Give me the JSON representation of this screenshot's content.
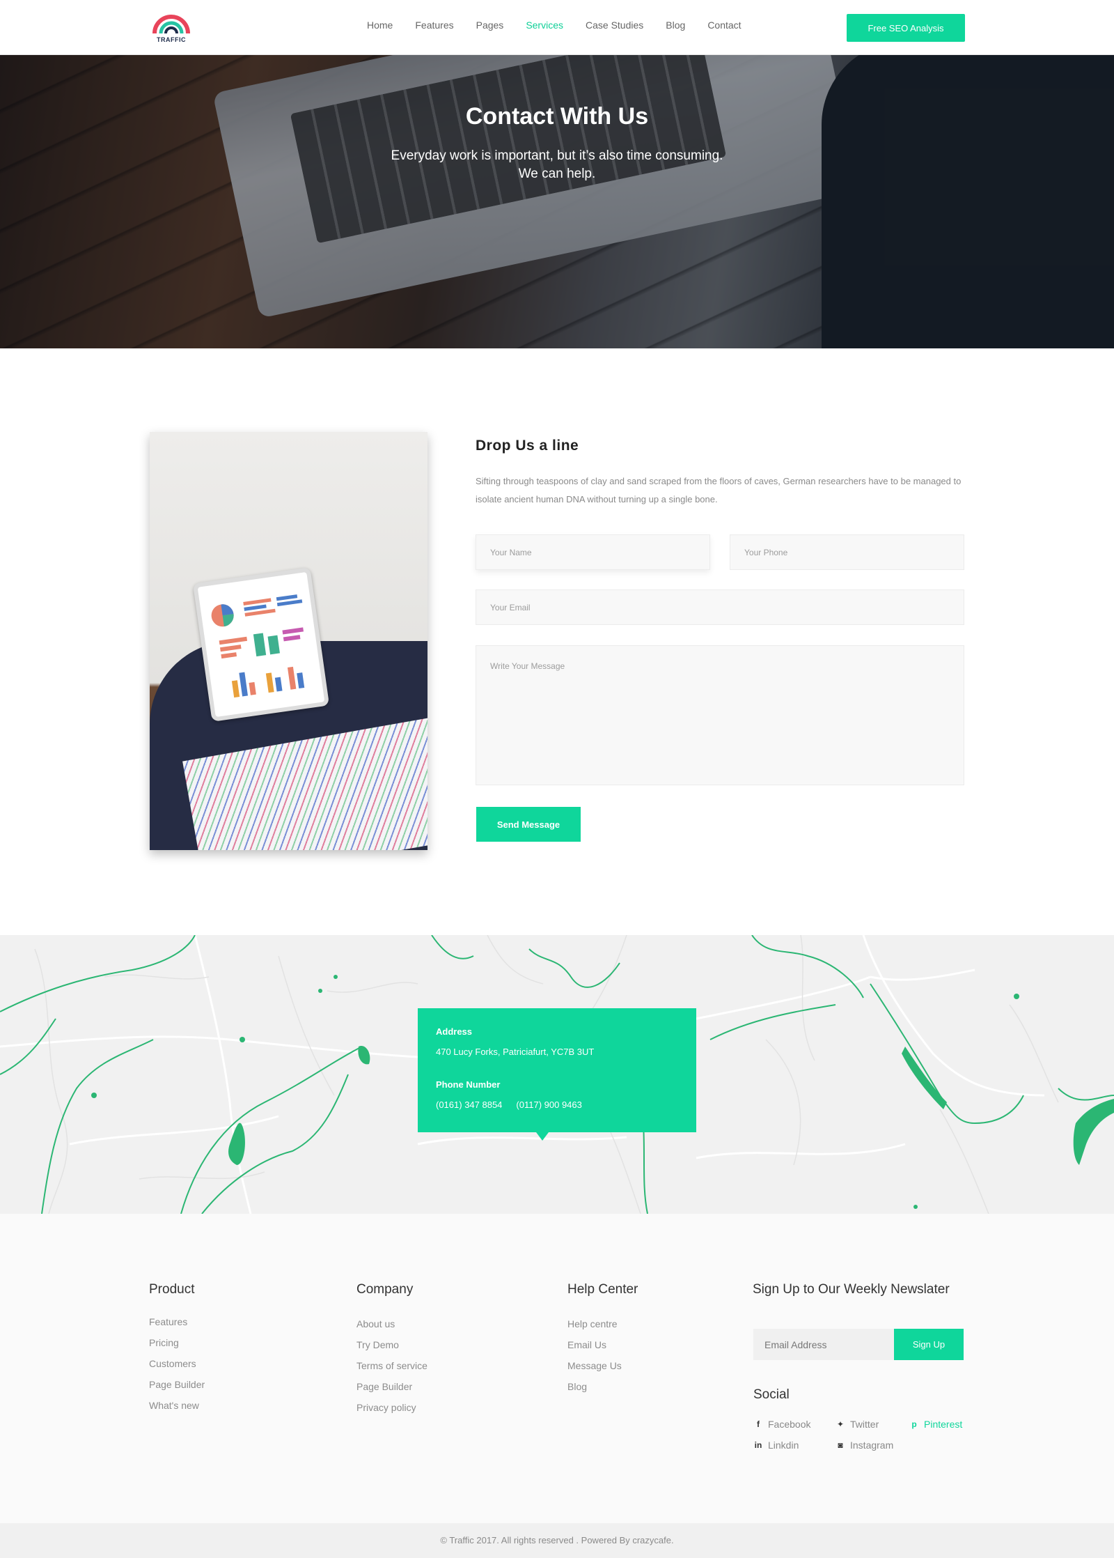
{
  "header": {
    "logo_text": "TRAFFIC",
    "nav": [
      "Home",
      "Features",
      "Pages",
      "Services",
      "Case Studies",
      "Blog",
      "Contact"
    ],
    "active_nav": "Services",
    "cta": "Free SEO Analysis"
  },
  "hero": {
    "title": "Contact With Us",
    "subtitle_line1": "Everyday work is important, but it’s also time consuming.",
    "subtitle_line2": "We can help."
  },
  "contact": {
    "title": "Drop Us a line",
    "description": "Sifting through teaspoons of clay and sand scraped from the floors of caves, German researchers have to be managed to isolate ancient human DNA without turning up a single bone.",
    "name_placeholder": "Your Name",
    "phone_placeholder": "Your Phone",
    "email_placeholder": "Your Email",
    "message_placeholder": "Write Your Message",
    "send_label": "Send Message"
  },
  "map_info": {
    "address_label": "Address",
    "address": "470 Lucy Forks, Patriciafurt, YC7B 3UT",
    "phone_label": "Phone Number",
    "phone1": "(0161) 347 8854",
    "phone2": "(0117) 900 9463"
  },
  "footer": {
    "product": {
      "title": "Product",
      "items": [
        "Features",
        "Pricing",
        "Customers",
        "Page Builder",
        "What's new"
      ]
    },
    "company": {
      "title": "Company",
      "items": [
        "About us",
        "Try Demo",
        "Terms of service",
        "Page Builder",
        "Privacy policy"
      ]
    },
    "help": {
      "title": "Help Center",
      "items": [
        "Help centre",
        "Email Us",
        "Message Us",
        "Blog"
      ]
    },
    "newsletter": {
      "title": "Sign Up to Our Weekly Newslater",
      "placeholder": "Email Address",
      "button": "Sign Up"
    },
    "social": {
      "title": "Social",
      "links": [
        {
          "label": "Facebook",
          "icon": "facebook-icon"
        },
        {
          "label": "Twitter",
          "icon": "twitter-icon"
        },
        {
          "label": "Pinterest",
          "icon": "pinterest-icon"
        },
        {
          "label": "Linkdin",
          "icon": "linkedin-icon"
        },
        {
          "label": "Instagram",
          "icon": "instagram-icon"
        }
      ]
    },
    "copyright": "© Traffic 2017. All rights reserved . Powered By crazycafe."
  },
  "colors": {
    "accent": "#0fd69b",
    "logo_red": "#e8445a",
    "logo_navy": "#1d2b4a"
  }
}
